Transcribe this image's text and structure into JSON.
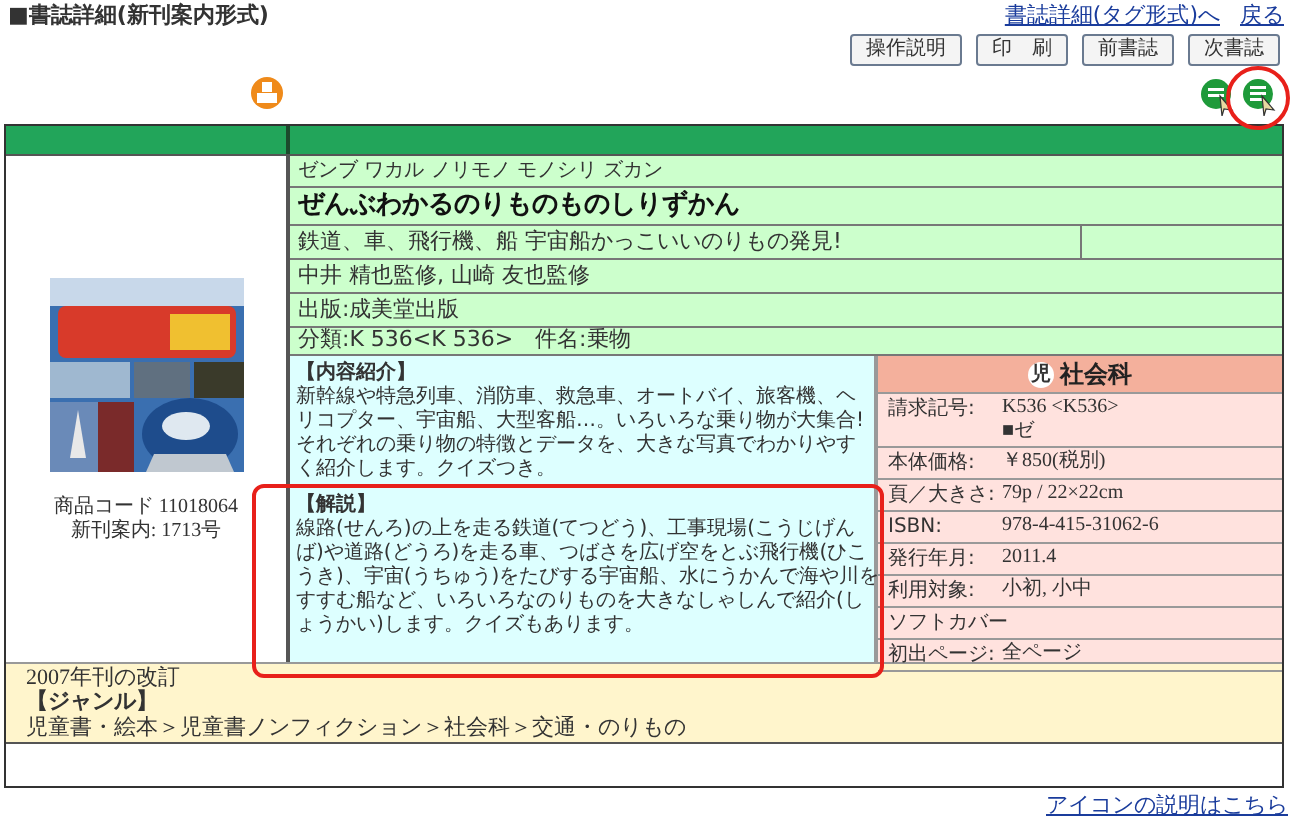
{
  "page_title": "■書誌詳細(新刊案内形式)",
  "header_links": [
    {
      "label": "書誌詳細(タグ形式)へ"
    },
    {
      "label": "戻る"
    }
  ],
  "buttons": [
    "操作説明",
    "印　刷",
    "前書誌",
    "次書誌"
  ],
  "book": {
    "reading": "ゼンブ ワカル ノリモノ モノシリ ズカン",
    "title": "ぜんぶわかるのりものものしりずかん",
    "subtitle": "鉄道、車、飛行機、船 宇宙船かっこいいのりもの発見!",
    "authors": "中井 精也監修, 山崎 友也監修",
    "publisher": "出版:成美堂出版",
    "classification": "分類:K 536<K 536>　件名:乗物",
    "product_code": "商品コード 11018064",
    "catalog_issue": "新刊案内: 1713号"
  },
  "description": [
    {
      "heading": "【内容紹介】",
      "text": "新幹線や特急列車、消防車、救急車、オートバイ、旅客機、ヘリコプター、宇宙船、大型客船…。いろいろな乗り物が大集合! それぞれの乗り物の特徴とデータを、大きな写真でわかりやすく紹介します。クイズつき。"
    },
    {
      "heading": "【解説】",
      "text": "線路(せんろ)の上を走る鉄道(てつどう)、工事現場(こうじげんば)や道路(どうろ)を走る車、つばさを広げ空をとぶ飛行機(ひこうき)、宇宙(うちゅう)をたびする宇宙船、水にうかんで海や川をすすむ船など、いろいろなのりものを大きなしゃしんで紹介(しょうかい)します。クイズもあります。"
    }
  ],
  "subject": {
    "badge": "児",
    "label": "社会科"
  },
  "details": [
    {
      "label": "請求記号:",
      "values": [
        "K536 <K536>",
        "■ゼ"
      ]
    },
    {
      "label": "本体価格:",
      "values": [
        "￥850(税別)"
      ]
    },
    {
      "label": "頁／大きさ:",
      "values": [
        "79p / 22×22cm"
      ]
    },
    {
      "label": "ISBN:",
      "values": [
        "978-4-415-31062-6"
      ]
    },
    {
      "label": "発行年月:",
      "values": [
        "2011.4"
      ]
    },
    {
      "label": "利用対象:",
      "values": [
        "小初, 小中"
      ]
    },
    {
      "label": "ソフトカバー"
    },
    {
      "label": "初出ページ:",
      "values": [
        "全ページ"
      ]
    }
  ],
  "note": "2007年刊の改訂",
  "genre_heading": "【ジャンル】",
  "genre_path": "児童書・絵本＞児童書ノンフィクション＞社会科＞交通・のりもの",
  "footer_link": "アイコンの説明はこちら"
}
